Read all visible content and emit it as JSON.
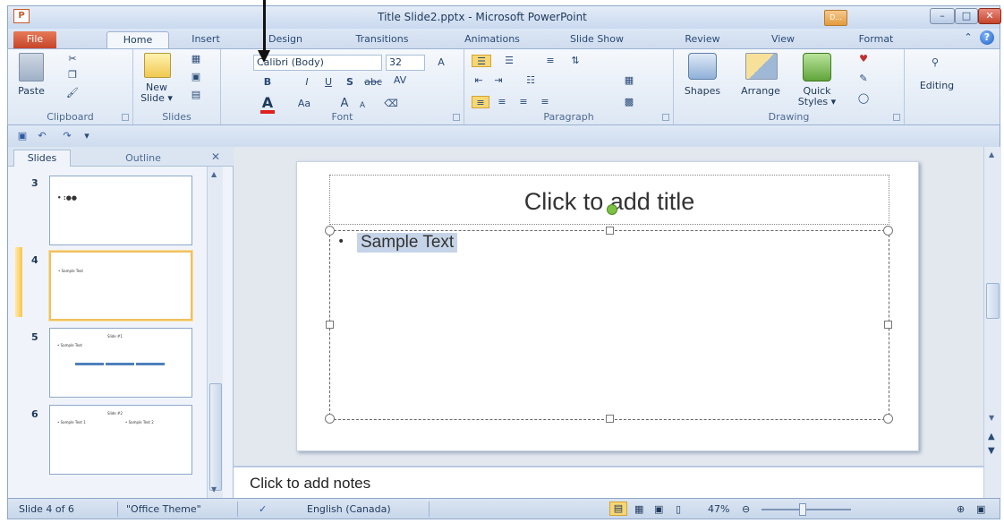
{
  "window": {
    "title": "Title Slide2.pptx - Microsoft PowerPoint",
    "app_icon": "P",
    "doc_button": "D..."
  },
  "tabs": {
    "file": "File",
    "home": "Home",
    "insert": "Insert",
    "design": "Design",
    "transitions": "Transitions",
    "animations": "Animations",
    "slideshow": "Slide Show",
    "review": "Review",
    "view": "View",
    "format": "Format"
  },
  "ribbon": {
    "clipboard": {
      "label": "Clipboard",
      "paste": "Paste"
    },
    "slides": {
      "label": "Slides",
      "new_slide": "New",
      "new_slide_2": "Slide ▾"
    },
    "font": {
      "label": "Font",
      "font_name": "Calibri (Body)",
      "font_size": "32",
      "bold": "B",
      "italic": "I",
      "underline": "U",
      "strike": "S",
      "abc": "abc",
      "spacing": "AV",
      "font_color": "A",
      "change_case": "Aa",
      "grow": "A",
      "shrink": "A"
    },
    "paragraph": {
      "label": "Paragraph"
    },
    "drawing": {
      "label": "Drawing",
      "shapes": "Shapes",
      "arrange": "Arrange",
      "quick_styles": "Quick",
      "quick_styles_2": "Styles ▾"
    },
    "editing": {
      "label": "Editing"
    }
  },
  "slides_pane": {
    "tab_slides": "Slides",
    "tab_outline": "Outline",
    "thumbs": [
      {
        "num": "3"
      },
      {
        "num": "4",
        "text": "• Sample Text"
      },
      {
        "num": "5",
        "title": "Slide #1",
        "text": "• Sample Text"
      },
      {
        "num": "6",
        "title": "Slide #2",
        "text_a": "• Sample Text 1",
        "text_b": "• Sample Text 2"
      }
    ]
  },
  "slide": {
    "title_placeholder": "Click to add title",
    "bullet": "•",
    "body_text": "Sample Text"
  },
  "notes": {
    "placeholder": "Click to add notes"
  },
  "status": {
    "slide_of": "Slide 4 of 6",
    "theme": "\"Office Theme\"",
    "language": "English (Canada)",
    "zoom": "47%"
  },
  "colors": {
    "font_color_bar": "#e02020",
    "accent": "#4f81bd",
    "file_tab": "#c6452a"
  },
  "icons": [
    "paste-icon",
    "cut-icon",
    "copy-icon",
    "format-painter-icon",
    "new-slide-icon",
    "layout-icon",
    "shapes-icon",
    "arrange-icon",
    "quick-styles-icon",
    "find-icon",
    "save-icon",
    "undo-icon",
    "redo-icon",
    "help-icon"
  ]
}
